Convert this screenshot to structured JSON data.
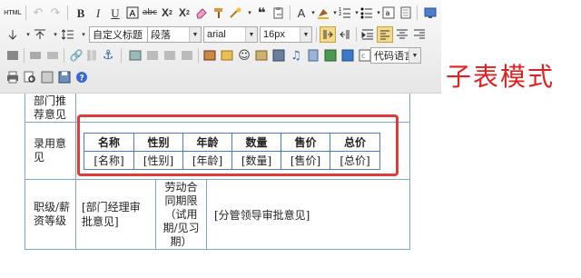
{
  "toolbar": {
    "html_label": "HTML",
    "style_select": "自定义标题",
    "paragraph_select": "段落",
    "font_select": "arial",
    "size_select": "16px",
    "code_lang_select": "代码语言"
  },
  "form": {
    "rows": [
      {
        "label": "部门推荐意见"
      },
      {
        "label": "录用意见"
      },
      {
        "label": "职级/薪资等级"
      }
    ],
    "subtable": {
      "headers": [
        "名称",
        "性别",
        "年龄",
        "数量",
        "售价",
        "总价"
      ],
      "values": [
        "[名称]",
        "[性别]",
        "[年龄]",
        "[数量]",
        "[售价]",
        "[总价]"
      ]
    },
    "manager_opinion": "[部门经理审批意见]",
    "labor_contract_label": "劳动合同期限（试用期/见习期）",
    "leader_opinion": "[分管领导审批意见]"
  },
  "annotation": "子表模式",
  "colors": {
    "annotation": "#e02020",
    "highlight_border": "#e03a3a",
    "table_border": "#7da6cc"
  }
}
